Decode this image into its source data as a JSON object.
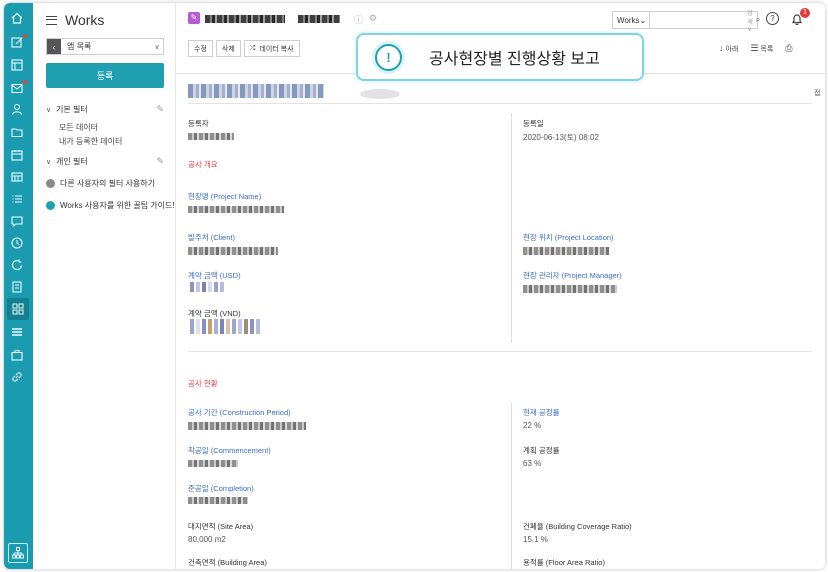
{
  "app": {
    "title": "Works",
    "app_list_label": "앱 목록",
    "register_label": "등록"
  },
  "filters": {
    "basic_title": "기본 필터",
    "basic_items": [
      "모든 데이터",
      "내가 등록한 데이터"
    ],
    "personal_title": "개인 필터",
    "other_user_filter": "다른 사용자의 필터 사용하기",
    "guide": "Works 사용자를 위한 꿀팁 가이드!"
  },
  "header": {
    "search_scope": "Works",
    "search_detail": "상세 ∨",
    "notification_count": "1"
  },
  "toolbar": {
    "edit": "수정",
    "delete": "삭제",
    "copy": "데이터 복사",
    "down": "아래",
    "list": "목록"
  },
  "callout": {
    "text": "공사현장별 진행상황 보고"
  },
  "record": {
    "side_mark": "접",
    "registrant_label": "등록자",
    "registered_date_label": "등록일",
    "registered_date": "2020-06-13(토) 08:02",
    "section_overview": "공사 개요",
    "project_name_label": "현장명 (Project Name)",
    "client_label": "발주처 (Client)",
    "project_location_label": "현장 위치 (Project Location)",
    "contract_usd_label": "계약 금액 (USD)",
    "project_manager_label": "현장 관리자 (Project Manager)",
    "contract_vnd_label": "계약 금액 (VND)",
    "section_status": "공사 현황",
    "construction_period_label": "공사 기간 (Construction Period)",
    "current_progress_label": "현재 공정률",
    "current_progress": "22 %",
    "commencement_label": "착공일 (Commencement)",
    "planned_progress_label": "계획 공정률",
    "planned_progress": "63 %",
    "completion_label": "준공일 (Completion)",
    "site_area_label": "대지면적 (Site Area)",
    "site_area": "80,000 m2",
    "building_coverage_label": "건폐율 (Building Coverage Ratio)",
    "building_coverage": "15.1 %",
    "building_area_label": "건축면적 (Building Area)",
    "floor_area_ratio_label": "용적률 (Floor Area Ratio)"
  },
  "colors": {
    "rail": "#1b9bb0",
    "primary_button": "#1f9fb0",
    "section_red": "#e3463f",
    "label_blue": "#3b6cc7",
    "callout_border": "#7fd3e4"
  }
}
